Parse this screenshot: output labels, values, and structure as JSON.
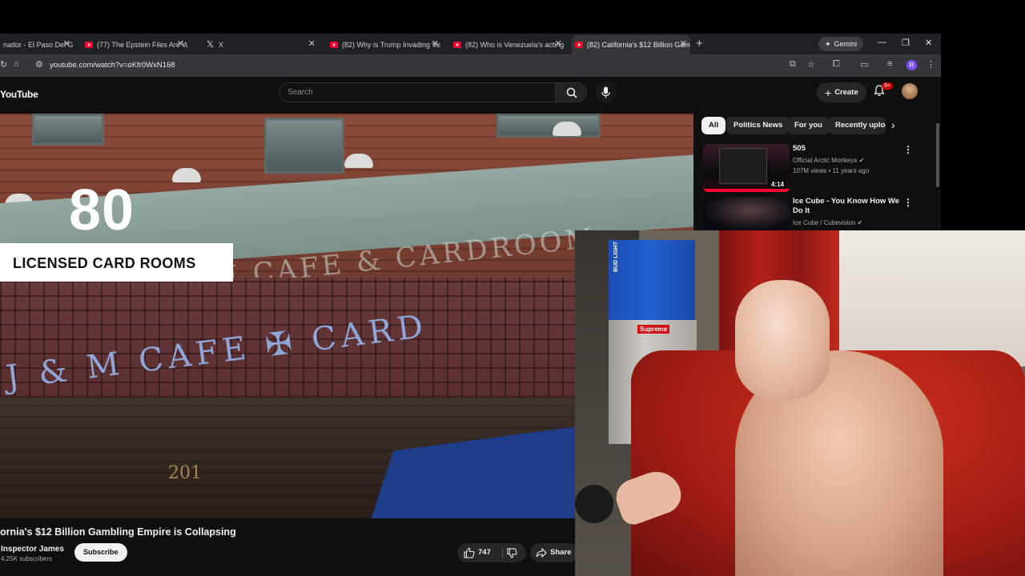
{
  "browser": {
    "tabs": [
      {
        "label": "nador - El Paso Del Gi",
        "fav": "youtube-icon"
      },
      {
        "label": "(77) The Epstein Files Are Way",
        "fav": "youtube-icon"
      },
      {
        "label": "X",
        "fav": "x-icon"
      },
      {
        "label": "(82) Why is Trump Invading Ve",
        "fav": "youtube-icon"
      },
      {
        "label": "(82) Who is Venezuela's acting",
        "fav": "youtube-icon"
      },
      {
        "label": "(82) California's $12 Billion Gam",
        "fav": "youtube-icon"
      }
    ],
    "new_tab": "+",
    "gemini": "Gemini",
    "url": "youtube.com/watch?v=oKfr0WxN168",
    "profile_initial": "R"
  },
  "youtube": {
    "logo": "YouTube",
    "search_placeholder": "Search",
    "create_label": "Create",
    "notifications_badge": "9+",
    "video": {
      "overlay_number": "80",
      "overlay_caption": "LICENSED CARD ROOMS",
      "sign_text": "J & M CAFE & CARDROOM",
      "glass_text": "J & M CAFE  ✠  CARD",
      "address_number": "201"
    },
    "title": "ornia's $12 Billion Gambling Empire is Collapsing",
    "channel": {
      "name": "Inspector James",
      "subscribers": "4.25K subscribers",
      "subscribe_label": "Subscribe"
    },
    "likes": "747",
    "share_label": "Share",
    "chips": [
      "All",
      "Politics News",
      "For you",
      "Recently uploa"
    ],
    "recommendations": [
      {
        "title": "505",
        "channel": "Official Arctic Monkeys",
        "meta": "107M views • 11 years ago",
        "duration": "4:14"
      },
      {
        "title": "Ice Cube - You Know How We Do It",
        "channel": "Ice Cube / Cubevision",
        "meta": "",
        "duration": ""
      }
    ]
  },
  "webcam": {
    "box_label": "BUD LIGHT",
    "fridge_label": "Supreme"
  },
  "colors": {
    "yt_red": "#ff0033",
    "bg": "#0f0f0f",
    "chip_bg": "#272727"
  }
}
